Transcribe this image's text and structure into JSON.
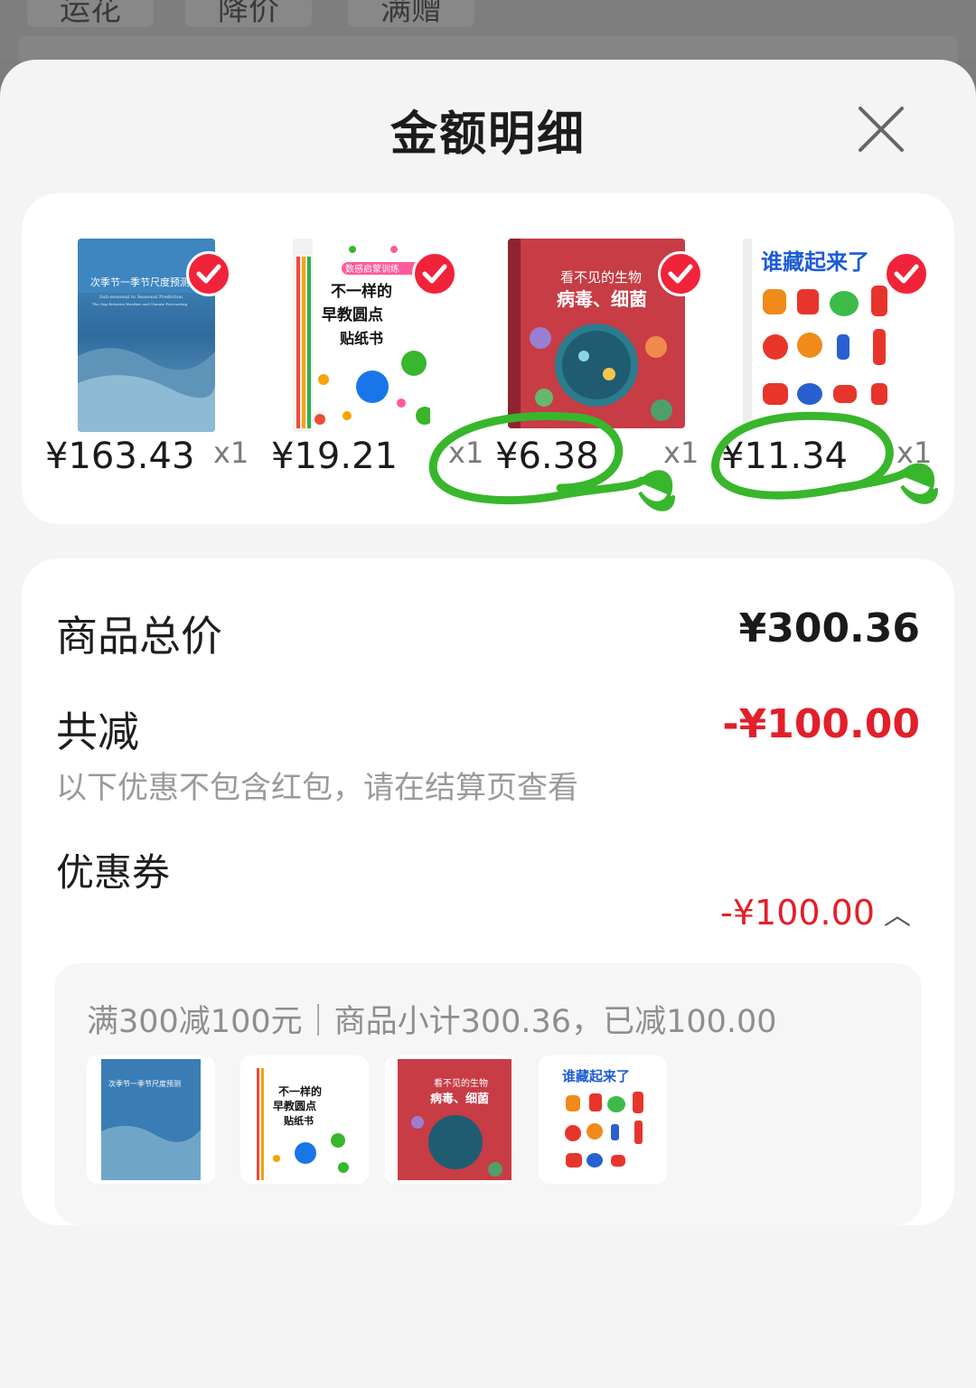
{
  "background_tabs": [
    "运花",
    "降价",
    "满赠"
  ],
  "sheet": {
    "title": "金额明细",
    "close_icon": "close-icon"
  },
  "products": [
    {
      "name": "次季节—季节尺度预测",
      "price": "¥163.43",
      "qty": "x1",
      "selected": true
    },
    {
      "name": "不一样的早教圆点贴纸书",
      "price": "¥19.21",
      "qty": "x1",
      "selected": true
    },
    {
      "name": "看不见的生物 病毒、细菌",
      "price": "¥6.38",
      "qty": "x1",
      "selected": true
    },
    {
      "name": "谁藏起来了",
      "price": "¥11.34",
      "qty": "x1",
      "selected": true
    }
  ],
  "book_cover_text": {
    "b1_title": "次季节一季节尺度预测",
    "b1_sub": "Sub-seasonal to Seasonal Prediction",
    "b1_sub2": "The Gap Between Weather and Climate Forecasting",
    "b2_badge": "数感启蒙训练",
    "b2_title1": "不一样的",
    "b2_title2": "早教圆点",
    "b2_title3": "贴纸书",
    "b3_title1": "看不见的生物",
    "b3_title2": "病毒、细菌",
    "b4_title": "谁藏起来了"
  },
  "summary": {
    "total_label": "商品总价",
    "total_value": "¥300.36",
    "reduce_label": "共减",
    "reduce_value": "-¥100.00",
    "note": "以下优惠不包含红包，请在结算页查看",
    "coupon_label": "优惠券",
    "coupon_value": "-¥100.00",
    "coupon_desc": "满300减100元｜商品小计300.36，已减100.00"
  },
  "colors": {
    "accent_red": "#e21f2a",
    "scribble_green": "#38b62c"
  }
}
